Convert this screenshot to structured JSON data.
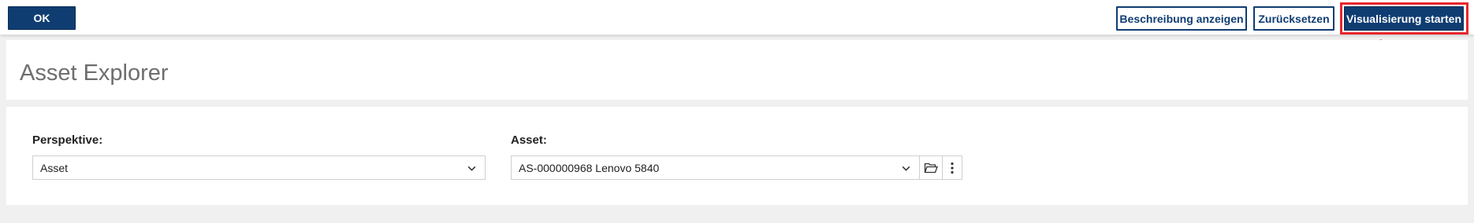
{
  "toolbar": {
    "ok_label": "OK",
    "describe_label": "Beschreibung anzeigen",
    "reset_label": "Zurücksetzen",
    "visualize_label": "Visualisierung starten"
  },
  "page": {
    "title": "Asset Explorer"
  },
  "form": {
    "perspective": {
      "label": "Perspektive:",
      "value": "Asset"
    },
    "asset": {
      "label": "Asset:",
      "value": "AS-000000968 Lenovo 5840"
    }
  },
  "colors": {
    "primary": "#0f3d72",
    "highlight": "#e8262d",
    "background": "#f0f0f0"
  },
  "icons": [
    "chevron-down-icon",
    "folder-open-icon",
    "more-vertical-icon",
    "arrow-annotation"
  ]
}
